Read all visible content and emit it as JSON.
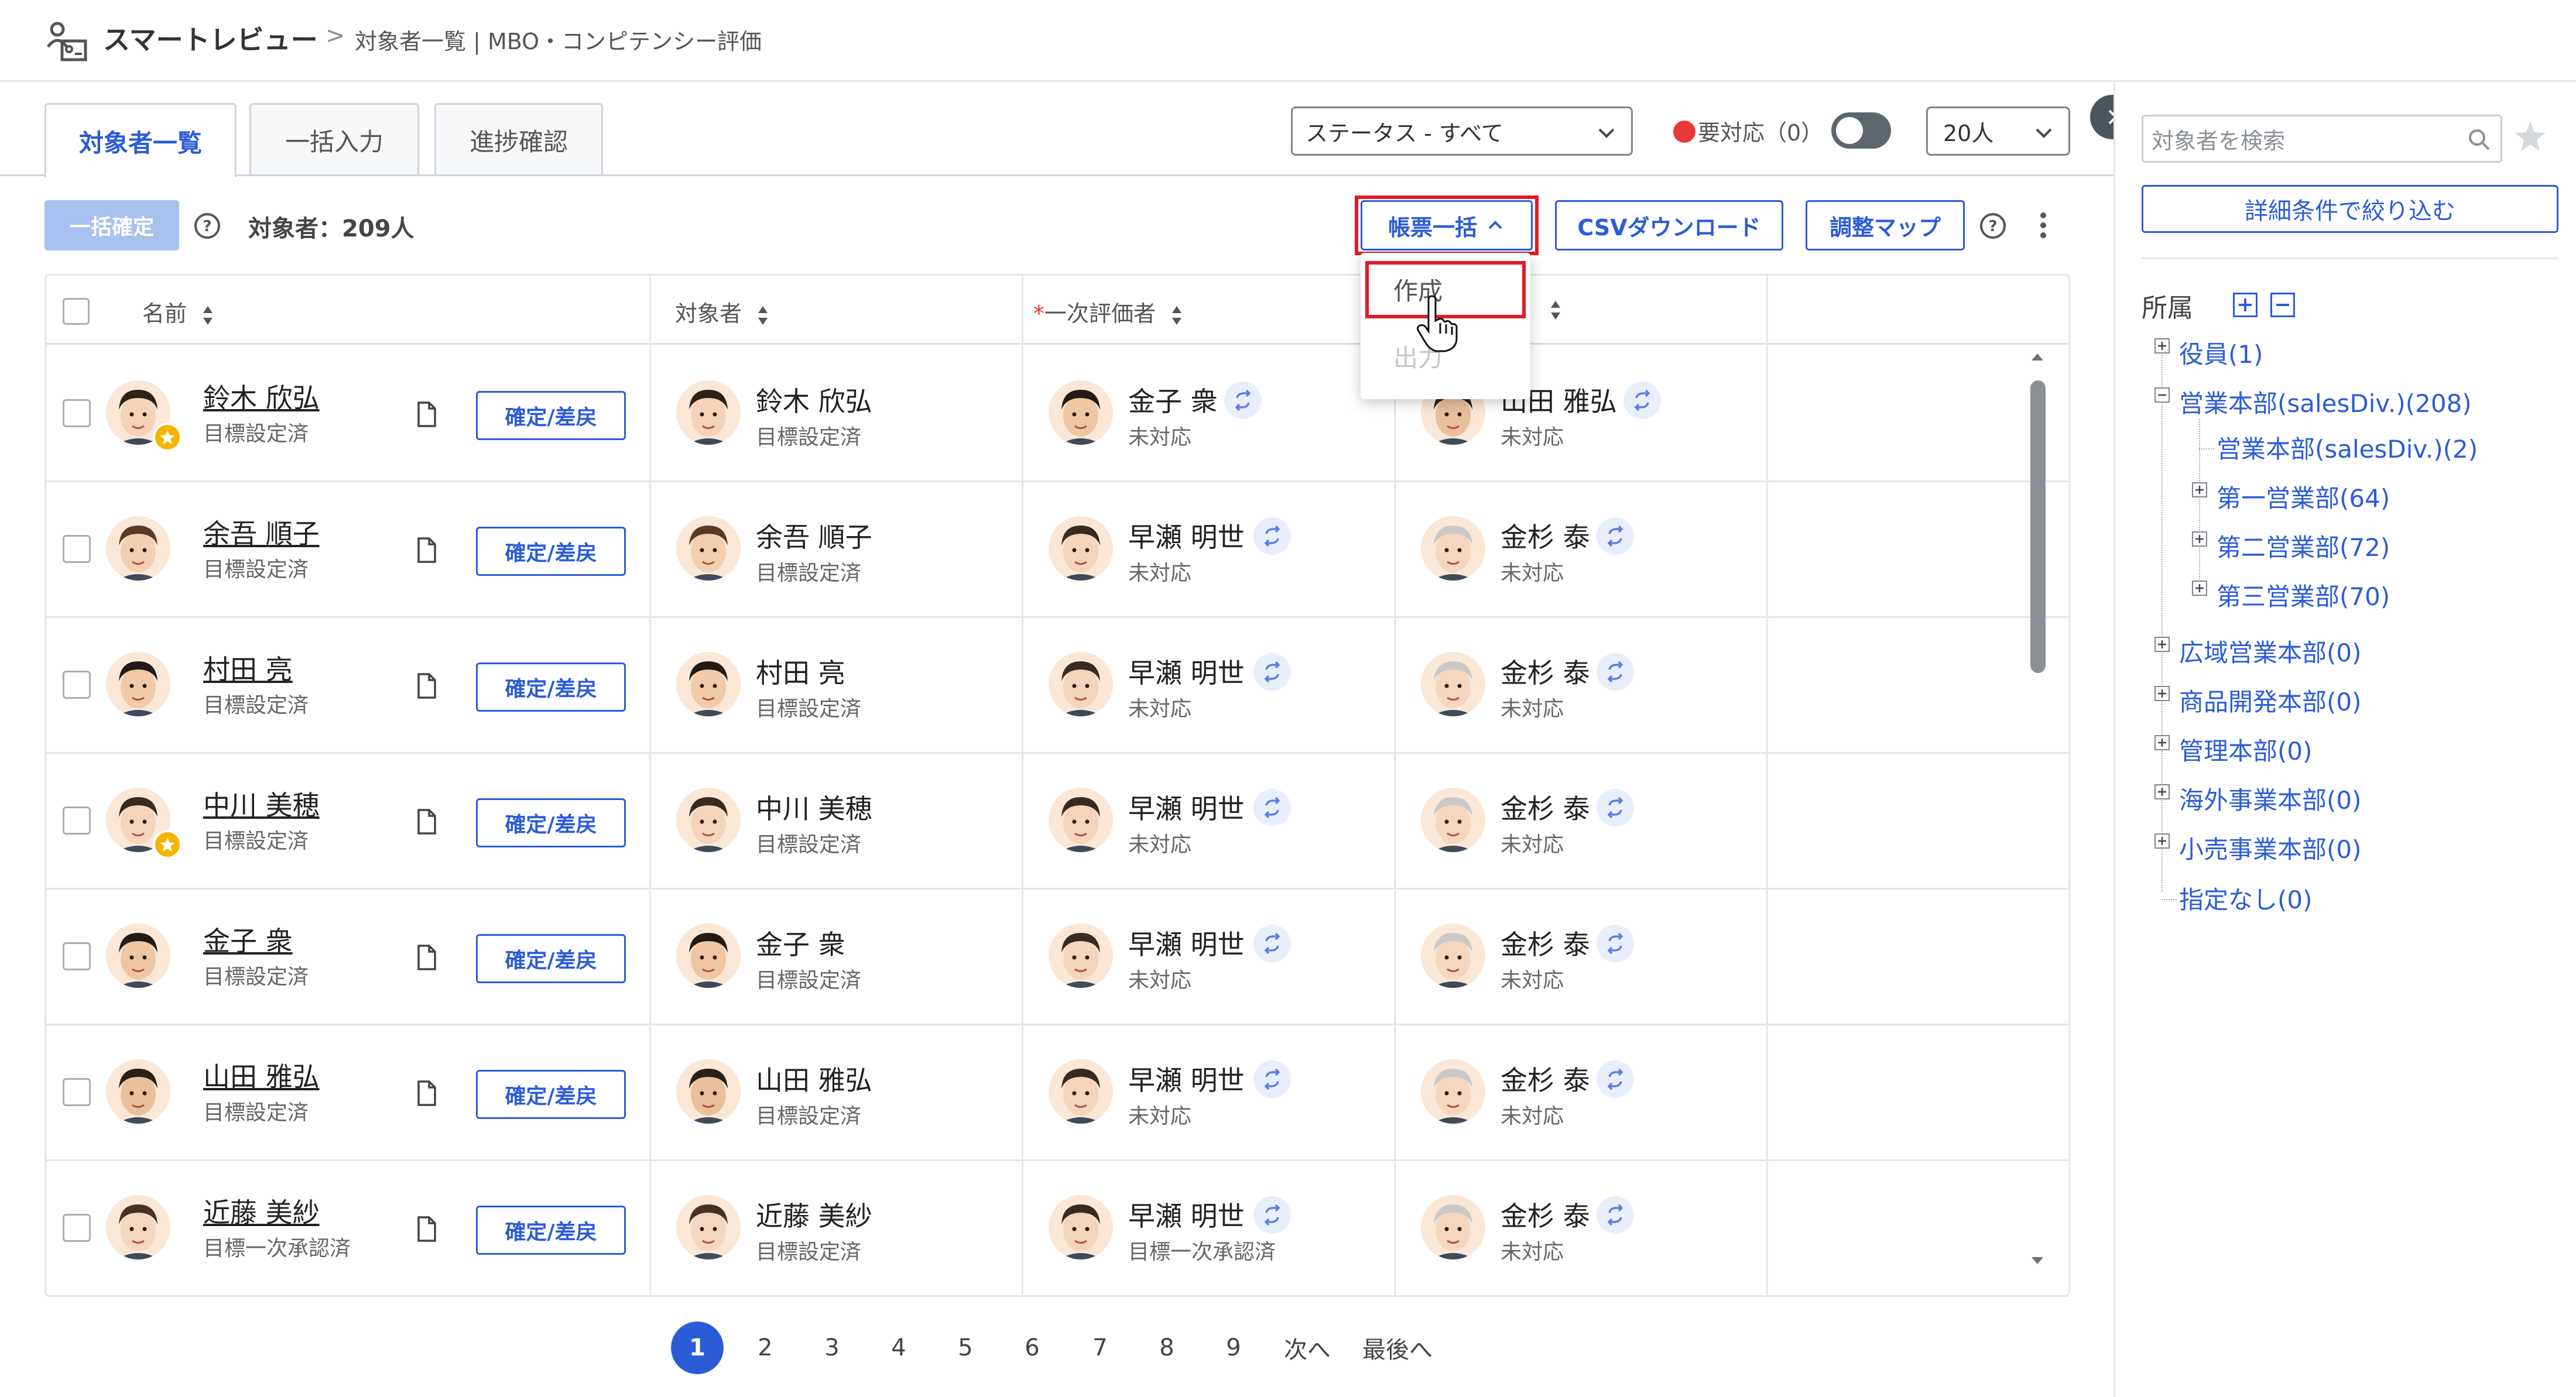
{
  "header": {
    "app_name": "スマートレビュー",
    "breadcrumb_sep": ">",
    "breadcrumb": "対象者一覧 | MBO・コンピテンシー評価"
  },
  "tabs": [
    {
      "label": "対象者一覧",
      "active": true
    },
    {
      "label": "一括入力",
      "active": false
    },
    {
      "label": "進捗確認",
      "active": false
    }
  ],
  "filters": {
    "status_select": "ステータス - すべて",
    "needs_action_label": "要対応（0）",
    "needs_action_on": false,
    "per_page": "20人"
  },
  "toolbar": {
    "bulk_confirm": "一括確定",
    "target_count": "対象者：209人",
    "forms_bulk": "帳票一括",
    "csv_download": "CSVダウンロード",
    "adjust_map": "調整マップ"
  },
  "forms_dropdown": {
    "create": "作成",
    "output": "出力"
  },
  "table": {
    "columns": {
      "name": "名前",
      "target": "対象者",
      "first_eval_required": "*",
      "first_eval": "一次評価者"
    },
    "confirm_label": "確定/差戻",
    "rows": [
      {
        "name": "鈴木 欣弘",
        "status": "目標設定済",
        "starred": true,
        "target_name": "鈴木 欣弘",
        "target_status": "目標設定済",
        "ev1_name": "金子 衆",
        "ev1_status": "未対応",
        "ev2_name": "山田 雅弘",
        "ev2_status": "未対応"
      },
      {
        "name": "余吾 順子",
        "status": "目標設定済",
        "starred": false,
        "target_name": "余吾 順子",
        "target_status": "目標設定済",
        "ev1_name": "早瀬 明世",
        "ev1_status": "未対応",
        "ev2_name": "金杉 泰",
        "ev2_status": "未対応"
      },
      {
        "name": "村田 亮",
        "status": "目標設定済",
        "starred": false,
        "target_name": "村田 亮",
        "target_status": "目標設定済",
        "ev1_name": "早瀬 明世",
        "ev1_status": "未対応",
        "ev2_name": "金杉 泰",
        "ev2_status": "未対応"
      },
      {
        "name": "中川 美穂",
        "status": "目標設定済",
        "starred": true,
        "target_name": "中川 美穂",
        "target_status": "目標設定済",
        "ev1_name": "早瀬 明世",
        "ev1_status": "未対応",
        "ev2_name": "金杉 泰",
        "ev2_status": "未対応"
      },
      {
        "name": "金子 衆",
        "status": "目標設定済",
        "starred": false,
        "target_name": "金子 衆",
        "target_status": "目標設定済",
        "ev1_name": "早瀬 明世",
        "ev1_status": "未対応",
        "ev2_name": "金杉 泰",
        "ev2_status": "未対応"
      },
      {
        "name": "山田 雅弘",
        "status": "目標設定済",
        "starred": false,
        "target_name": "山田 雅弘",
        "target_status": "目標設定済",
        "ev1_name": "早瀬 明世",
        "ev1_status": "未対応",
        "ev2_name": "金杉 泰",
        "ev2_status": "未対応"
      },
      {
        "name": "近藤 美紗",
        "status": "目標一次承認済",
        "starred": false,
        "target_name": "近藤 美紗",
        "target_status": "目標設定済",
        "ev1_name": "早瀬 明世",
        "ev1_status": "目標一次承認済",
        "ev2_name": "金杉 泰",
        "ev2_status": "未対応"
      }
    ]
  },
  "pagination": {
    "pages": [
      "1",
      "2",
      "3",
      "4",
      "5",
      "6",
      "7",
      "8",
      "9"
    ],
    "current": "1",
    "next": "次へ",
    "last": "最後へ"
  },
  "right_panel": {
    "search_placeholder": "対象者を検索",
    "detail_filter": "詳細条件で絞り込む",
    "department_title": "所属",
    "tree": [
      {
        "label": "役員(1)"
      },
      {
        "label": "営業本部(salesDiv.)(208)"
      },
      {
        "label": "営業本部(salesDiv.)(2)"
      },
      {
        "label": "第一営業部(64)"
      },
      {
        "label": "第二営業部(72)"
      },
      {
        "label": "第三営業部(70)"
      },
      {
        "label": "広域営業本部(0)"
      },
      {
        "label": "商品開発本部(0)"
      },
      {
        "label": "管理本部(0)"
      },
      {
        "label": "海外事業本部(0)"
      },
      {
        "label": "小売事業本部(0)"
      },
      {
        "label": "指定なし(0)"
      }
    ]
  },
  "colors": {
    "accent": "#2b5cd8",
    "highlight": "#e01b24",
    "alert": "#e53935",
    "star": "#f4b400"
  }
}
